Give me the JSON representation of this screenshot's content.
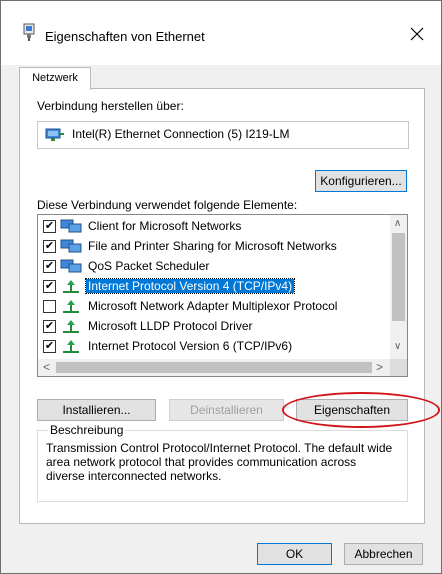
{
  "window": {
    "title": "Eigenschaften von Ethernet",
    "close_icon": "close-icon",
    "title_icon": "network-adapter-icon"
  },
  "tabs": [
    {
      "label": "Netzwerk",
      "active": true
    }
  ],
  "connect_using": {
    "label": "Verbindung herstellen über:",
    "adapter": "Intel(R) Ethernet Connection (5) I219-LM",
    "adapter_icon": "network-adapter-icon"
  },
  "buttons": {
    "configure": "Konfigurieren...",
    "install": "Installieren...",
    "uninstall": "Deinstallieren",
    "properties": "Eigenschaften",
    "ok": "OK",
    "cancel": "Abbrechen"
  },
  "components": {
    "label": "Diese Verbindung verwendet folgende Elemente:",
    "items": [
      {
        "label": "Client for Microsoft Networks",
        "checked": true,
        "icon": "client-network-icon",
        "selected": false
      },
      {
        "label": "File and Printer Sharing for Microsoft Networks",
        "checked": true,
        "icon": "file-sharing-icon",
        "selected": false
      },
      {
        "label": "QoS Packet Scheduler",
        "checked": true,
        "icon": "qos-scheduler-icon",
        "selected": false
      },
      {
        "label": "Internet Protocol Version 4 (TCP/IPv4)",
        "checked": true,
        "icon": "protocol-icon",
        "selected": true
      },
      {
        "label": "Microsoft Network Adapter Multiplexor Protocol",
        "checked": false,
        "icon": "protocol-icon",
        "selected": false
      },
      {
        "label": "Microsoft LLDP Protocol Driver",
        "checked": true,
        "icon": "protocol-icon",
        "selected": false
      },
      {
        "label": "Internet Protocol Version 6 (TCP/IPv6)",
        "checked": true,
        "icon": "protocol-icon",
        "selected": false
      }
    ]
  },
  "description": {
    "title": "Beschreibung",
    "text": "Transmission Control Protocol/Internet Protocol. The default wide area network protocol that provides communication across diverse interconnected networks."
  },
  "colors": {
    "selection": "#0078d7",
    "annotation": "#d0161b"
  }
}
